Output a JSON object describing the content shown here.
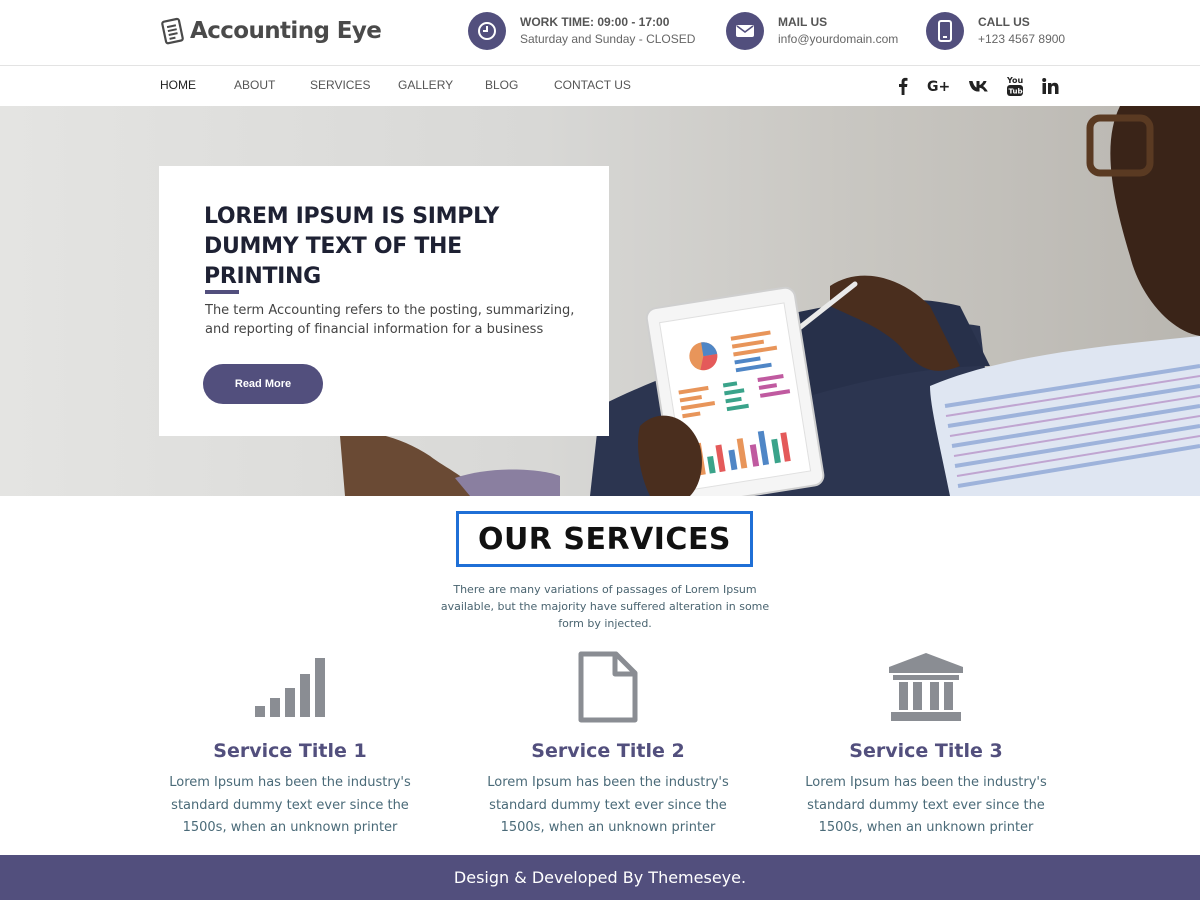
{
  "brand": {
    "name": "Accounting Eye",
    "icon": "ledger-icon"
  },
  "header": {
    "work_time": {
      "title": "WORK TIME: 09:00 - 17:00",
      "sub": "Saturday and Sunday - CLOSED",
      "icon": "clock-icon"
    },
    "mail": {
      "title": "MAIL US",
      "sub": "info@yourdomain.com",
      "icon": "envelope-icon"
    },
    "call": {
      "title": "CALL US",
      "sub": "+123 4567 8900",
      "icon": "phone-icon"
    }
  },
  "nav": {
    "items": [
      {
        "label": "HOME",
        "active": true
      },
      {
        "label": "ABOUT"
      },
      {
        "label": "SERVICES"
      },
      {
        "label": "GALLERY"
      },
      {
        "label": "BLOG"
      },
      {
        "label": "CONTACT US"
      }
    ],
    "social": [
      "facebook-icon",
      "google-plus-icon",
      "vk-icon",
      "youtube-icon",
      "linkedin-icon"
    ]
  },
  "hero": {
    "title": "LOREM IPSUM IS SIMPLY DUMMY TEXT OF THE PRINTING",
    "description": "The term Accounting refers to the posting, summarizing, and reporting of financial information for a business",
    "button": "Read More"
  },
  "services": {
    "heading": "OUR SERVICES",
    "description": "There are many variations of passages of Lorem Ipsum available, but the majority have suffered alteration in some form by injected.",
    "items": [
      {
        "title": "Service Title 1",
        "text": "Lorem Ipsum has been the industry's standard dummy text ever since the 1500s, when an unknown printer",
        "icon": "signal-bars-icon"
      },
      {
        "title": "Service Title 2",
        "text": "Lorem Ipsum has been the industry's standard dummy text ever since the 1500s, when an unknown printer",
        "icon": "document-icon"
      },
      {
        "title": "Service Title 3",
        "text": "Lorem Ipsum has been the industry's standard dummy text ever since the 1500s, when an unknown printer",
        "icon": "bank-icon"
      }
    ]
  },
  "footer": {
    "text": "Design & Developed By Themeseye."
  },
  "colors": {
    "accent": "#524f7d",
    "heading_border": "#1f6fd6",
    "icon_gray": "#8a8d93"
  }
}
